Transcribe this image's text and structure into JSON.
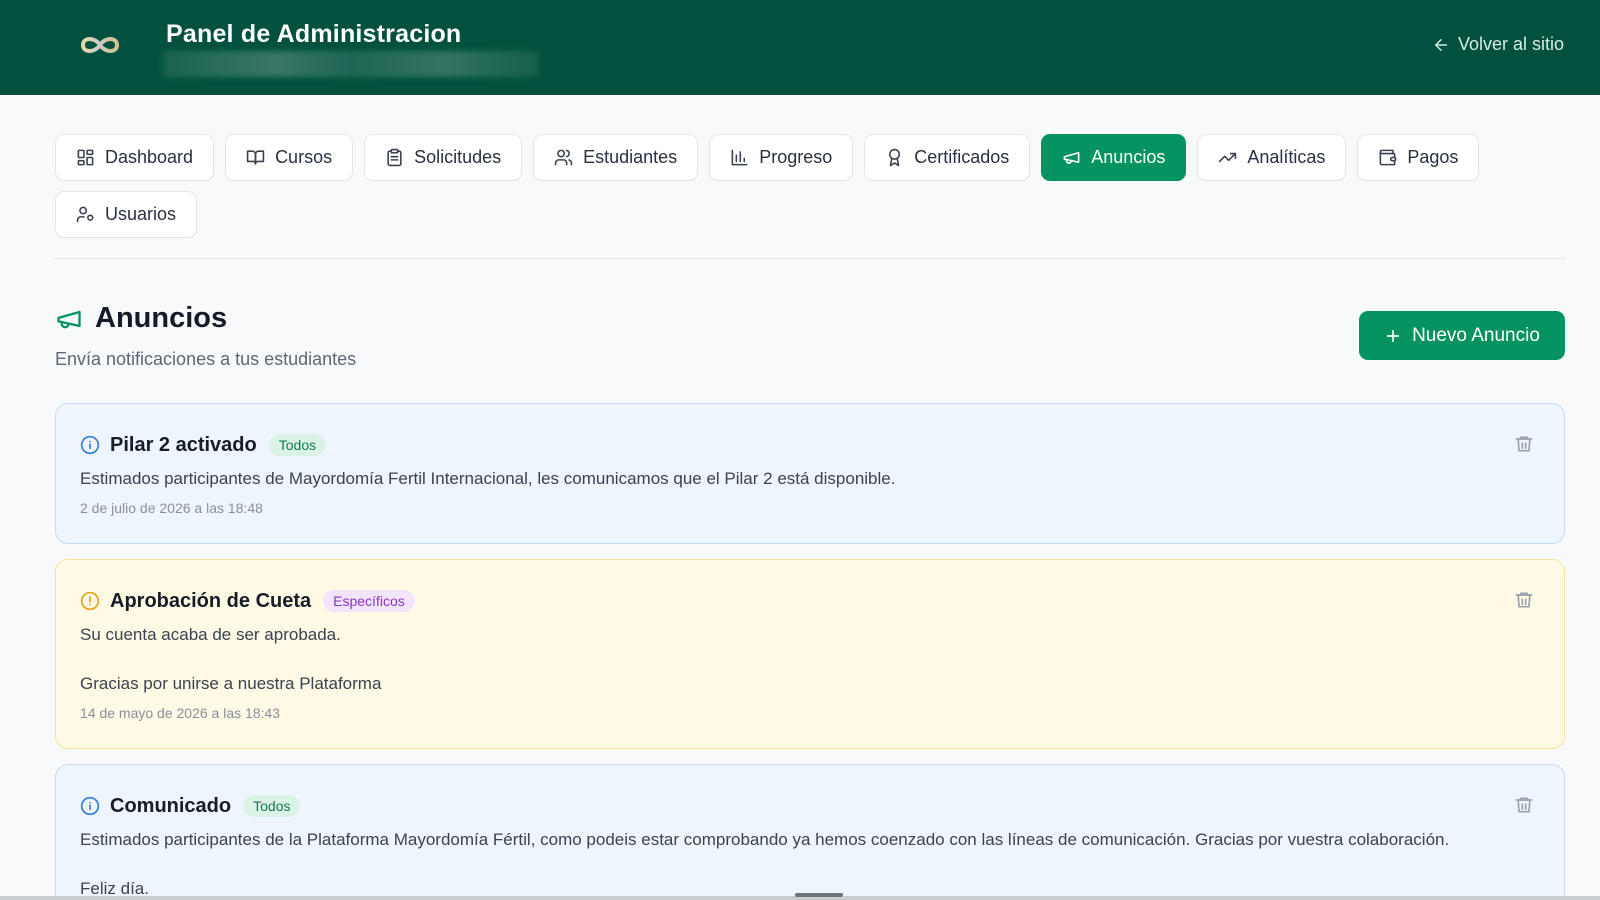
{
  "header": {
    "title": "Panel de Administracion",
    "back_label": "Volver al sitio"
  },
  "tabs": [
    {
      "label": "Dashboard",
      "icon": "dashboard-icon",
      "active": false
    },
    {
      "label": "Cursos",
      "icon": "book-icon",
      "active": false
    },
    {
      "label": "Solicitudes",
      "icon": "clipboard-icon",
      "active": false
    },
    {
      "label": "Estudiantes",
      "icon": "users-icon",
      "active": false
    },
    {
      "label": "Progreso",
      "icon": "bar-chart-icon",
      "active": false
    },
    {
      "label": "Certificados",
      "icon": "award-icon",
      "active": false
    },
    {
      "label": "Anuncios",
      "icon": "megaphone-icon",
      "active": true
    },
    {
      "label": "Analíticas",
      "icon": "trending-up-icon",
      "active": false
    },
    {
      "label": "Pagos",
      "icon": "wallet-icon",
      "active": false
    },
    {
      "label": "Usuarios",
      "icon": "user-cog-icon",
      "active": false
    }
  ],
  "section": {
    "title": "Anuncios",
    "subtitle": "Envía notificaciones a tus estudiantes",
    "new_button": "Nuevo Anuncio"
  },
  "announcements": [
    {
      "title": "Pilar 2 activado",
      "badge": "Todos",
      "type": "info",
      "body": [
        "Estimados participantes de Mayordomía Fertil Internacional, les comunicamos que el Pilar 2 está disponible."
      ],
      "date": "2 de julio de 2026 a las 18:48"
    },
    {
      "title": "Aprobación de Cueta",
      "badge": "Específicos",
      "type": "warn",
      "body": [
        "Su cuenta acaba de ser aprobada.",
        "Gracias por unirse a nuestra Plataforma"
      ],
      "date": "14 de mayo de 2026 a las 18:43"
    },
    {
      "title": "Comunicado",
      "badge": "Todos",
      "type": "info",
      "body": [
        "Estimados participantes de la Plataforma Mayordomía Fértil, como podeis estar comprobando ya hemos coenzado con las líneas de comunicación. Gracias por vuestra colaboración.",
        "Feliz día."
      ],
      "date": ""
    }
  ],
  "colors": {
    "header_bg": "#02513e",
    "accent": "#059461",
    "info_bg": "#eef5fc",
    "warn_bg": "#fffae6"
  }
}
